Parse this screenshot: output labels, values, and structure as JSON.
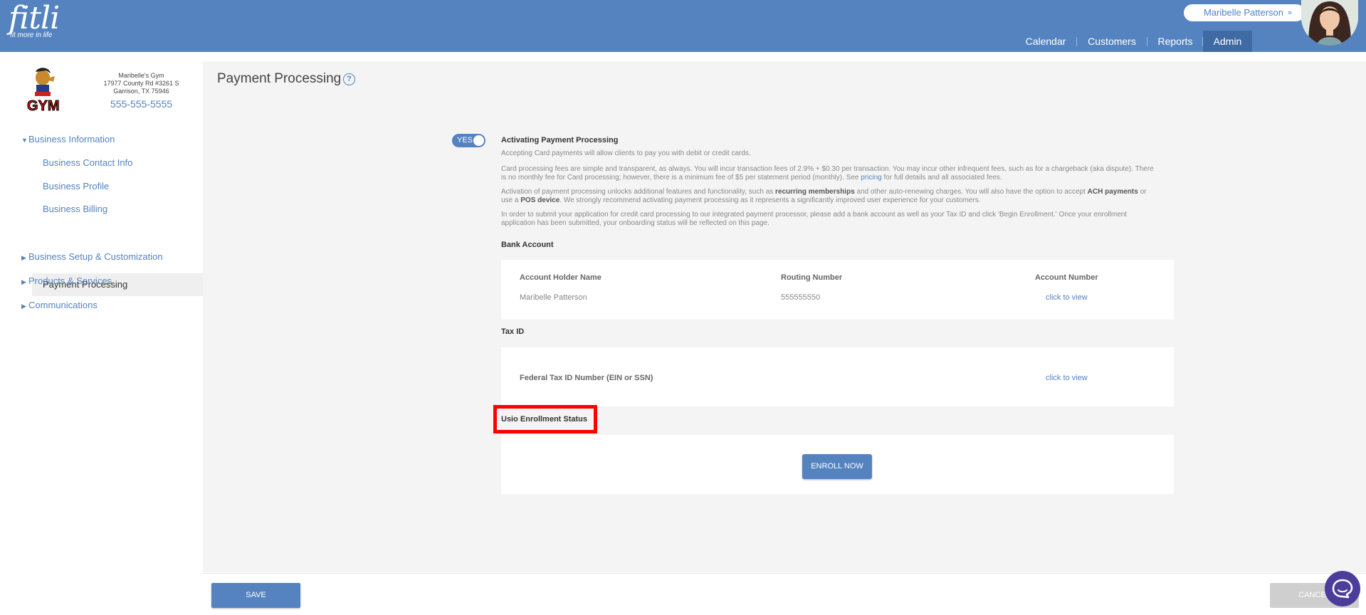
{
  "header": {
    "logo_text": "fitli",
    "logo_tagline": "fit more in life",
    "user_name": "Maribelle Patterson",
    "user_chevron": "»",
    "nav": [
      "Calendar",
      "Customers",
      "Reports",
      "Admin"
    ],
    "active_nav": "Admin"
  },
  "business": {
    "name": "Maribelle's Gym",
    "address1": "17977 County Rd #3261 S",
    "address2": "Garrison, TX 75946",
    "phone": "555-555-5555"
  },
  "sidebar": {
    "sections": [
      {
        "label": "Business Information",
        "expanded": true
      },
      {
        "label": "Business Setup & Customization",
        "expanded": false
      },
      {
        "label": "Products & Services",
        "expanded": false
      },
      {
        "label": "Communications",
        "expanded": false
      }
    ],
    "sub_items": [
      "Business Contact Info",
      "Business Profile",
      "Business Billing",
      "Payment Processing"
    ],
    "active_item": "Payment Processing"
  },
  "page": {
    "title": "Payment Processing",
    "help_icon": "?",
    "toggle_label": "YES",
    "activating_title": "Activating Payment Processing",
    "p1": "Accepting Card payments will allow clients to pay you with debit or credit cards.",
    "p2_a": "Card processing fees are simple and transparent, as always. You will incur transaction fees of 2.9% + $0.30 per transaction. You may incur other infrequent fees, such as for a chargeback (aka dispute). There is no monthly fee for Card processing; however, there is a minimum fee of $5 per statement period (monthly). See ",
    "p2_link": "pricing",
    "p2_b": " for full details and all associated fees.",
    "p3_a": "Activation of payment processing unlocks additional features and functionality, such as ",
    "p3_b1": "recurring memberships",
    "p3_c": " and other auto-renewing charges. You will also have the option to accept ",
    "p3_b2": "ACH payments",
    "p3_d": " or use a ",
    "p3_b3": "POS device",
    "p3_e": ". We strongly recommend activating payment processing as it represents a significantly improved user experience for your customers.",
    "p4": "In order to submit your application for credit card processing to our integrated payment processor, please add a bank account as well as your Tax ID and click 'Begin Enrollment.' Once your enrollment application has been submitted, your onboarding status will be reflected on this page."
  },
  "bank_account": {
    "title": "Bank Account",
    "headers": [
      "Account Holder Name",
      "Routing Number",
      "Account Number"
    ],
    "holder": "Maribelle Patterson",
    "routing": "555555550",
    "account_link": "click to view"
  },
  "tax": {
    "title": "Tax ID",
    "label": "Federal Tax ID Number (EIN or SSN)",
    "link": "click to view"
  },
  "enrollment": {
    "title": "Usio Enrollment Status",
    "button": "ENROLL NOW"
  },
  "footer": {
    "save": "SAVE",
    "cancel": "CANCEL"
  },
  "colors": {
    "brand": "#5583c0",
    "highlight": "#ff0000",
    "chat": "#4d3d9a"
  }
}
